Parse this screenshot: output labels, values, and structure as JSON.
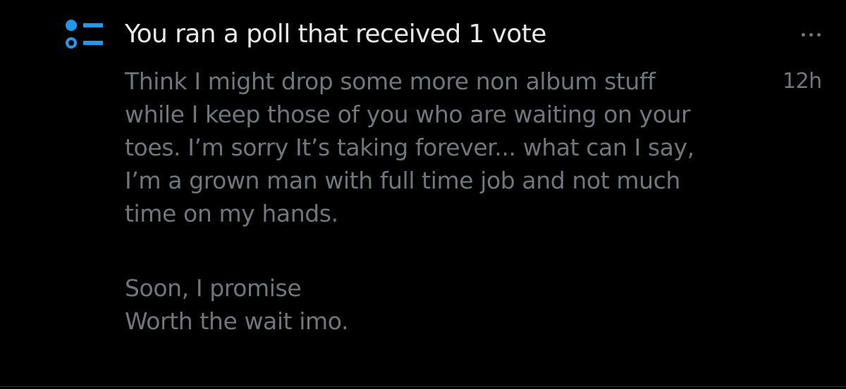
{
  "notification": {
    "icon": "poll-icon",
    "title": "You ran a poll that received 1 vote",
    "timestamp": "12h",
    "more_icon": "more-horizontal-icon",
    "body_lines_p1": [
      "Think I might drop some more non album stuff",
      "while I keep those of you who are waiting on your",
      "toes. I’m sorry It’s taking forever... what can I say,",
      "I’m a grown man with full time job and not much",
      "time on my hands."
    ],
    "body_lines_p2": [
      "Soon, I promise",
      "Worth the wait imo."
    ]
  },
  "colors": {
    "background": "#000000",
    "accent": "#1d9bf0",
    "title_text": "#e7e9ea",
    "secondary_text": "#71767b",
    "divider": "#2f3336"
  }
}
